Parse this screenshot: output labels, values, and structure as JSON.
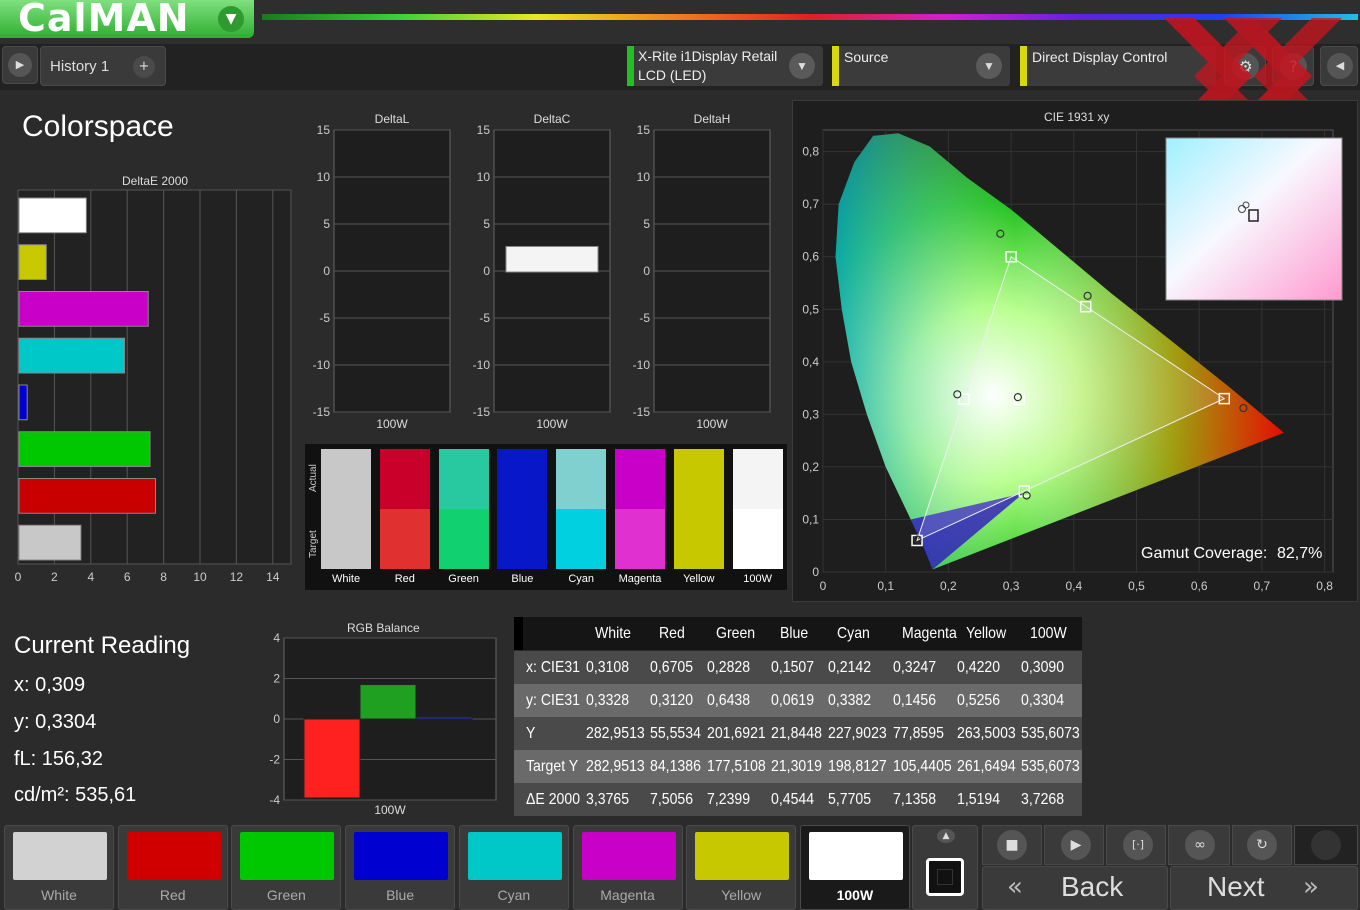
{
  "app": {
    "logo": "CalMAN"
  },
  "toolbar": {
    "history_tab": "History 1",
    "add_tab": "+",
    "meter_line1": "X-Rite i1Display Retail",
    "meter_line2": "LCD (LED)",
    "source": "Source",
    "display_control": "Direct Display Control"
  },
  "page": {
    "title": "Colorspace"
  },
  "deltae_chart": {
    "title": "DeltaE 2000",
    "ticks": [
      "0",
      "2",
      "4",
      "6",
      "8",
      "10",
      "12",
      "14"
    ]
  },
  "delta_charts": [
    {
      "title": "DeltaL",
      "xlabel": "100W"
    },
    {
      "title": "DeltaC",
      "xlabel": "100W"
    },
    {
      "title": "DeltaH",
      "xlabel": "100W"
    }
  ],
  "delta_ticks": [
    "15",
    "10",
    "5",
    "0",
    "-5",
    "-10",
    "-15"
  ],
  "patch_compare": {
    "actual_label": "Actual",
    "target_label": "Target",
    "patches": [
      {
        "name": "White",
        "actual": "#c8c8c8",
        "target": "#c8c8c8"
      },
      {
        "name": "Red",
        "actual": "#c8002a",
        "target": "#e03030"
      },
      {
        "name": "Green",
        "actual": "#28c8a0",
        "target": "#10d070"
      },
      {
        "name": "Blue",
        "actual": "#0818c8",
        "target": "#0818c8"
      },
      {
        "name": "Cyan",
        "actual": "#80d0d0",
        "target": "#00d0e0"
      },
      {
        "name": "Magenta",
        "actual": "#c800c8",
        "target": "#e030d0"
      },
      {
        "name": "Yellow",
        "actual": "#c8c800",
        "target": "#c8c800"
      },
      {
        "name": "100W",
        "actual": "#f4f4f4",
        "target": "#ffffff"
      }
    ]
  },
  "cie": {
    "title": "CIE 1931 xy",
    "x_ticks": [
      "0",
      "0,1",
      "0,2",
      "0,3",
      "0,4",
      "0,5",
      "0,6",
      "0,7",
      "0,8"
    ],
    "y_ticks": [
      "0,8",
      "0,7",
      "0,6",
      "0,5",
      "0,4",
      "0,3",
      "0,2",
      "0,1",
      "0"
    ],
    "gamut_label": "Gamut Coverage:",
    "gamut_value": "82,7%"
  },
  "current_reading": {
    "title": "Current Reading",
    "x": "x: 0,309",
    "y": "y: 0,3304",
    "fl": "fL: 156,32",
    "cdm2": "cd/m²: 535,61"
  },
  "rgb_balance": {
    "title": "RGB Balance",
    "xlabel": "100W",
    "ticks": [
      "4",
      "2",
      "0",
      "-2",
      "-4"
    ]
  },
  "table": {
    "headers": [
      "White",
      "Red",
      "Green",
      "Blue",
      "Cyan",
      "Magenta",
      "Yellow",
      "100W"
    ],
    "rows": [
      {
        "label": "x: CIE31",
        "values": [
          "0,3108",
          "0,6705",
          "0,2828",
          "0,1507",
          "0,2142",
          "0,3247",
          "0,4220",
          "0,3090"
        ]
      },
      {
        "label": "y: CIE31",
        "values": [
          "0,3328",
          "0,3120",
          "0,6438",
          "0,0619",
          "0,3382",
          "0,1456",
          "0,5256",
          "0,3304"
        ]
      },
      {
        "label": "Y",
        "values": [
          "282,9513",
          "55,5534",
          "201,6921",
          "21,8448",
          "227,9023",
          "77,8595",
          "263,5003",
          "535,6073"
        ]
      },
      {
        "label": "Target Y",
        "values": [
          "282,9513",
          "84,1386",
          "177,5108",
          "21,3019",
          "198,8127",
          "105,4405",
          "261,6494",
          "535,6073"
        ]
      },
      {
        "label": "ΔE 2000",
        "values": [
          "3,3765",
          "7,5056",
          "7,2399",
          "0,4544",
          "5,7705",
          "7,1358",
          "1,5194",
          "3,7268"
        ]
      }
    ]
  },
  "swatches": [
    {
      "name": "White",
      "color": "#d2d2d2"
    },
    {
      "name": "Red",
      "color": "#d00000"
    },
    {
      "name": "Green",
      "color": "#00c800"
    },
    {
      "name": "Blue",
      "color": "#0000d0"
    },
    {
      "name": "Cyan",
      "color": "#00c8c8"
    },
    {
      "name": "Magenta",
      "color": "#c800c8"
    },
    {
      "name": "Yellow",
      "color": "#c8c800"
    },
    {
      "name": "100W",
      "color": "#ffffff"
    }
  ],
  "nav": {
    "back": "Back",
    "next": "Next"
  },
  "chart_data": [
    {
      "type": "bar",
      "title": "DeltaE 2000",
      "categories": [
        "White",
        "Yellow",
        "Magenta",
        "Cyan",
        "Blue",
        "Green",
        "Red",
        "100W"
      ],
      "values": [
        3.7,
        1.5,
        7.1,
        5.8,
        0.45,
        7.2,
        7.5,
        3.4
      ],
      "colors": [
        "#ffffff",
        "#c8c800",
        "#c800c8",
        "#00c8c8",
        "#0000d0",
        "#00c800",
        "#c80000",
        "#c8c8c8"
      ],
      "xlim": [
        0,
        15
      ]
    },
    {
      "type": "bar",
      "title": "DeltaL",
      "categories": [
        "100W"
      ],
      "values": [
        0
      ],
      "ylim": [
        -15,
        15
      ]
    },
    {
      "type": "bar",
      "title": "DeltaC",
      "categories": [
        "100W"
      ],
      "values": [
        2.5
      ],
      "ylim": [
        -15,
        15
      ]
    },
    {
      "type": "bar",
      "title": "DeltaH",
      "categories": [
        "100W"
      ],
      "values": [
        0
      ],
      "ylim": [
        -15,
        15
      ]
    },
    {
      "type": "bar",
      "title": "RGB Balance",
      "categories": [
        "100W"
      ],
      "series": [
        {
          "name": "R",
          "values": [
            -3.9
          ]
        },
        {
          "name": "G",
          "values": [
            1.7
          ]
        },
        {
          "name": "B",
          "values": [
            0.1
          ]
        }
      ],
      "ylim": [
        -4,
        4
      ]
    },
    {
      "type": "scatter",
      "title": "CIE 1931 xy",
      "xlim": [
        0,
        0.8
      ],
      "ylim": [
        0,
        0.8
      ],
      "target_gamut": [
        [
          0.64,
          0.33
        ],
        [
          0.3,
          0.6
        ],
        [
          0.15,
          0.06
        ]
      ],
      "target_points": [
        {
          "x": 0.3127,
          "y": 0.329
        },
        {
          "x": 0.64,
          "y": 0.33
        },
        {
          "x": 0.3,
          "y": 0.6
        },
        {
          "x": 0.15,
          "y": 0.06
        },
        {
          "x": 0.225,
          "y": 0.329
        },
        {
          "x": 0.321,
          "y": 0.154
        },
        {
          "x": 0.419,
          "y": 0.505
        }
      ],
      "measured_points": [
        {
          "x": 0.3108,
          "y": 0.3328
        },
        {
          "x": 0.6705,
          "y": 0.312
        },
        {
          "x": 0.2828,
          "y": 0.6438
        },
        {
          "x": 0.1507,
          "y": 0.0619
        },
        {
          "x": 0.2142,
          "y": 0.3382
        },
        {
          "x": 0.3247,
          "y": 0.1456
        },
        {
          "x": 0.422,
          "y": 0.5256
        }
      ],
      "gamut_coverage": "82,7%"
    }
  ]
}
